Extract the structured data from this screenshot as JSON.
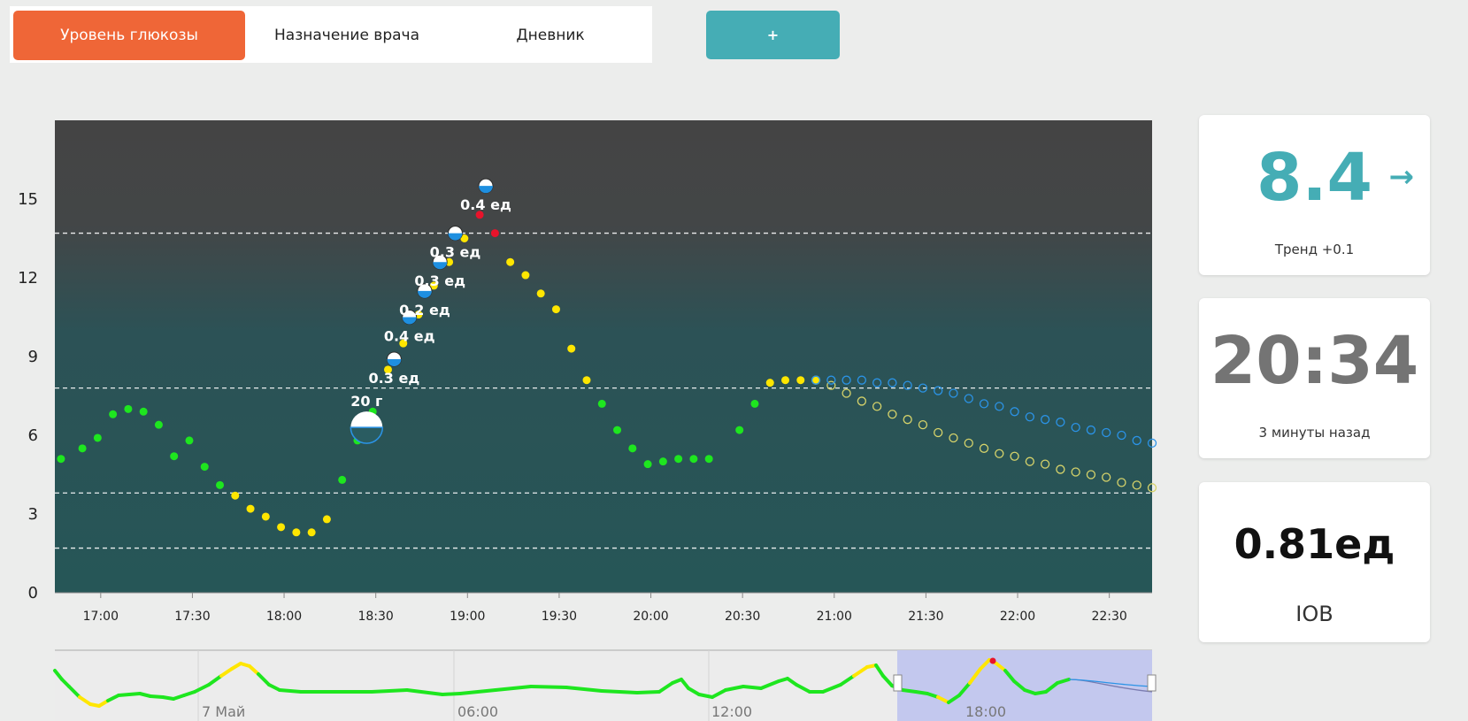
{
  "tabs": [
    {
      "label": "Уровень глюкозы",
      "active": true
    },
    {
      "label": "Назначение врача",
      "active": false
    },
    {
      "label": "Дневник",
      "active": false
    }
  ],
  "add_label": "+",
  "cards": {
    "glucose": {
      "value": "8.4",
      "trend": "Тренд +0.1",
      "arrow": "→",
      "color": "#45adb5"
    },
    "time": {
      "value": "20:34",
      "sub": "3 минуты назад"
    },
    "iob": {
      "value": "0.81ед",
      "sub": "IOB"
    }
  },
  "chart_data": {
    "type": "scatter",
    "y_ticks": [
      0,
      3,
      6,
      9,
      12,
      15
    ],
    "ylim": [
      0,
      18
    ],
    "x_ticks": [
      "17:00",
      "17:30",
      "18:00",
      "18:30",
      "19:00",
      "19:30",
      "20:00",
      "20:30",
      "21:00",
      "21:30",
      "22:00",
      "22:30"
    ],
    "x_start_min": 1005,
    "x_end_min": 1364,
    "reference_lines": [
      1.7,
      3.8,
      7.8,
      13.7
    ],
    "points": [
      {
        "t": 1007,
        "v": 5.1
      },
      {
        "t": 1014,
        "v": 5.5
      },
      {
        "t": 1019,
        "v": 5.9
      },
      {
        "t": 1024,
        "v": 6.8
      },
      {
        "t": 1029,
        "v": 7.0
      },
      {
        "t": 1034,
        "v": 6.9
      },
      {
        "t": 1039,
        "v": 6.4
      },
      {
        "t": 1044,
        "v": 5.2
      },
      {
        "t": 1049,
        "v": 5.8
      },
      {
        "t": 1054,
        "v": 4.8
      },
      {
        "t": 1059,
        "v": 4.1
      },
      {
        "t": 1064,
        "v": 3.7
      },
      {
        "t": 1069,
        "v": 3.2
      },
      {
        "t": 1074,
        "v": 2.9
      },
      {
        "t": 1079,
        "v": 2.5
      },
      {
        "t": 1084,
        "v": 2.3
      },
      {
        "t": 1089,
        "v": 2.3
      },
      {
        "t": 1094,
        "v": 2.8
      },
      {
        "t": 1099,
        "v": 4.3
      },
      {
        "t": 1104,
        "v": 5.8
      },
      {
        "t": 1109,
        "v": 6.9
      },
      {
        "t": 1114,
        "v": 8.5
      },
      {
        "t": 1119,
        "v": 9.5
      },
      {
        "t": 1124,
        "v": 10.6
      },
      {
        "t": 1129,
        "v": 11.7
      },
      {
        "t": 1134,
        "v": 12.6
      },
      {
        "t": 1139,
        "v": 13.5
      },
      {
        "t": 1144,
        "v": 14.4
      },
      {
        "t": 1149,
        "v": 13.7
      },
      {
        "t": 1154,
        "v": 12.6
      },
      {
        "t": 1159,
        "v": 12.1
      },
      {
        "t": 1164,
        "v": 11.4
      },
      {
        "t": 1169,
        "v": 10.8
      },
      {
        "t": 1174,
        "v": 9.3
      },
      {
        "t": 1179,
        "v": 8.1
      },
      {
        "t": 1184,
        "v": 7.2
      },
      {
        "t": 1189,
        "v": 6.2
      },
      {
        "t": 1194,
        "v": 5.5
      },
      {
        "t": 1199,
        "v": 4.9
      },
      {
        "t": 1204,
        "v": 5.0
      },
      {
        "t": 1209,
        "v": 5.1
      },
      {
        "t": 1214,
        "v": 5.1
      },
      {
        "t": 1219,
        "v": 5.1
      },
      {
        "t": 1229,
        "v": 6.2
      },
      {
        "t": 1234,
        "v": 7.2
      },
      {
        "t": 1239,
        "v": 8.0
      },
      {
        "t": 1244,
        "v": 8.1
      },
      {
        "t": 1249,
        "v": 8.1
      },
      {
        "t": 1254,
        "v": 8.1
      }
    ],
    "forecast_blue": [
      {
        "t": 1254,
        "v": 8.1
      },
      {
        "t": 1259,
        "v": 8.1
      },
      {
        "t": 1264,
        "v": 8.1
      },
      {
        "t": 1269,
        "v": 8.1
      },
      {
        "t": 1274,
        "v": 8.0
      },
      {
        "t": 1279,
        "v": 8.0
      },
      {
        "t": 1284,
        "v": 7.9
      },
      {
        "t": 1289,
        "v": 7.8
      },
      {
        "t": 1294,
        "v": 7.7
      },
      {
        "t": 1299,
        "v": 7.6
      },
      {
        "t": 1304,
        "v": 7.4
      },
      {
        "t": 1309,
        "v": 7.2
      },
      {
        "t": 1314,
        "v": 7.1
      },
      {
        "t": 1319,
        "v": 6.9
      },
      {
        "t": 1324,
        "v": 6.7
      },
      {
        "t": 1329,
        "v": 6.6
      },
      {
        "t": 1334,
        "v": 6.5
      },
      {
        "t": 1339,
        "v": 6.3
      },
      {
        "t": 1344,
        "v": 6.2
      },
      {
        "t": 1349,
        "v": 6.1
      },
      {
        "t": 1354,
        "v": 6.0
      },
      {
        "t": 1359,
        "v": 5.8
      },
      {
        "t": 1364,
        "v": 5.7
      }
    ],
    "forecast_yellow": [
      {
        "t": 1254,
        "v": 8.1
      },
      {
        "t": 1259,
        "v": 7.9
      },
      {
        "t": 1264,
        "v": 7.6
      },
      {
        "t": 1269,
        "v": 7.3
      },
      {
        "t": 1274,
        "v": 7.1
      },
      {
        "t": 1279,
        "v": 6.8
      },
      {
        "t": 1284,
        "v": 6.6
      },
      {
        "t": 1289,
        "v": 6.4
      },
      {
        "t": 1294,
        "v": 6.1
      },
      {
        "t": 1299,
        "v": 5.9
      },
      {
        "t": 1304,
        "v": 5.7
      },
      {
        "t": 1309,
        "v": 5.5
      },
      {
        "t": 1314,
        "v": 5.3
      },
      {
        "t": 1319,
        "v": 5.2
      },
      {
        "t": 1324,
        "v": 5.0
      },
      {
        "t": 1329,
        "v": 4.9
      },
      {
        "t": 1334,
        "v": 4.7
      },
      {
        "t": 1339,
        "v": 4.6
      },
      {
        "t": 1344,
        "v": 4.5
      },
      {
        "t": 1349,
        "v": 4.4
      },
      {
        "t": 1354,
        "v": 4.2
      },
      {
        "t": 1359,
        "v": 4.1
      },
      {
        "t": 1364,
        "v": 4.0
      }
    ],
    "insulin": [
      {
        "t": 1116,
        "v": 8.9,
        "label": "0.3 ед"
      },
      {
        "t": 1121,
        "v": 10.5,
        "label": "0.4 ед"
      },
      {
        "t": 1126,
        "v": 11.5,
        "label": "0.2 ед"
      },
      {
        "t": 1131,
        "v": 12.6,
        "label": "0.3 ед"
      },
      {
        "t": 1136,
        "v": 13.7,
        "label": "0.3 ед"
      },
      {
        "t": 1146,
        "v": 15.5,
        "label": "0.4 ед"
      }
    ],
    "carbs": [
      {
        "t": 1107,
        "v": 6.3,
        "label": "20 г"
      }
    ],
    "navigator": {
      "labels": [
        "7 Май",
        "06:00",
        "12:00",
        "18:00"
      ]
    }
  }
}
